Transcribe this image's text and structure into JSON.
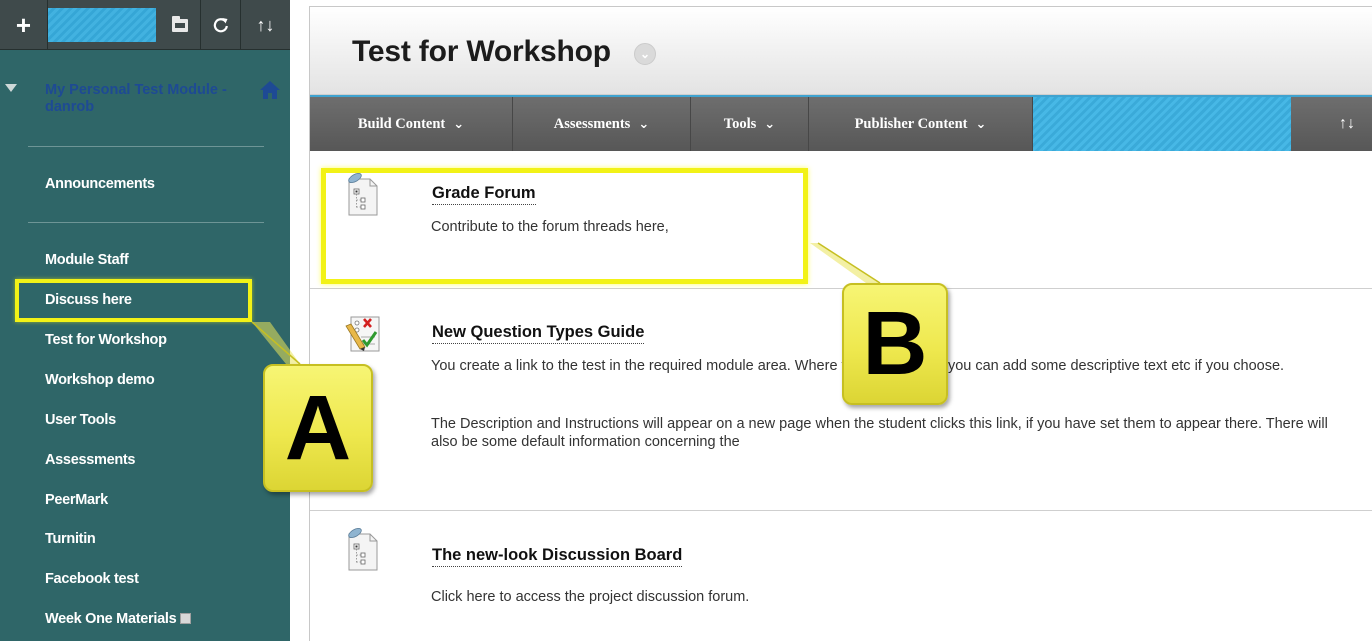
{
  "sidebar": {
    "toolbar": {
      "plus": "+",
      "folder_icon": "folder-icon",
      "refresh": "C",
      "sort": "↑↓"
    },
    "module_title": "My Personal Test Module - danrob",
    "links": [
      {
        "label": "Announcements"
      },
      {
        "label": "Module Staff"
      },
      {
        "label": "Discuss here"
      },
      {
        "label": "Test for Workshop"
      },
      {
        "label": "Workshop demo"
      },
      {
        "label": "User Tools"
      },
      {
        "label": "Assessments"
      },
      {
        "label": "PeerMark"
      },
      {
        "label": "Turnitin"
      },
      {
        "label": "Facebook test"
      },
      {
        "label": "Week One Materials"
      }
    ]
  },
  "page": {
    "title": "Test for Workshop"
  },
  "action_bar": {
    "items": [
      {
        "label": "Build Content"
      },
      {
        "label": "Assessments"
      },
      {
        "label": "Tools"
      },
      {
        "label": "Publisher Content"
      }
    ],
    "sort": "↑↓"
  },
  "content_items": [
    {
      "title": "Grade Forum",
      "descriptions": [
        "Contribute to the forum threads here,"
      ]
    },
    {
      "title": "New Question Types Guide",
      "descriptions": [
        "You create a link to the test in the required module area. Where the link appears you can add some descriptive text etc if you choose.",
        "The Description and Instructions will appear on a new page when the student clicks this link, if you have set them to appear there. There will also be some default information concerning the"
      ]
    },
    {
      "title": "The new-look Discussion Board",
      "descriptions": [
        "Click here to access the project discussion forum."
      ]
    }
  ],
  "callouts": {
    "a": "A",
    "b": "B"
  },
  "colors": {
    "sidebar_bg": "#2f6668",
    "module_title": "#1e4a94",
    "accent_blue": "#42b2e0",
    "highlight_yellow": "#f2f217",
    "action_bar": "#616161"
  }
}
